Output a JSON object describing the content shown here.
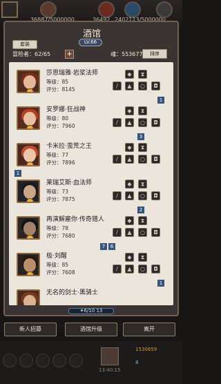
{
  "top_bar": {
    "resource_1_value": "36887",
    "resource_1_cap": "5000000",
    "resource_2_value": "36492",
    "resource_3_value": "2402113",
    "resource_3_cap": "5000000"
  },
  "tavern": {
    "title": "酒馆",
    "level": "LV.66",
    "tab_label": "套装",
    "adventurers_label": "冒险者：62/65",
    "add_label": "+",
    "soul_label": "魂：553677",
    "sort_label": "排序"
  },
  "heroes": [
    {
      "name": "莎恩瑞雅·岩浆法师",
      "level": "等级：85",
      "score": "评分：8145"
    },
    {
      "name": "安罗娜·狂战神",
      "level": "等级：80",
      "score": "评分：7960"
    },
    {
      "name": "卡米拉·蛮荒之王",
      "level": "等级：77",
      "score": "评分：7896"
    },
    {
      "name": "莱瑞艾斯·血法师",
      "level": "等级：73",
      "score": "评分：7875"
    },
    {
      "name": "再演解雇你·传奇猎人",
      "level": "等级：78",
      "score": "评分：7680"
    },
    {
      "name": "极·刘醒",
      "level": "等级：85",
      "score": "评分：7608"
    },
    {
      "name": "无名的剑士·黑骑士",
      "level": "",
      "score": ""
    }
  ],
  "side_tags": [
    "1",
    "3",
    "1",
    "2",
    "7",
    "6",
    "1"
  ],
  "exp_text": "✦6/10 13",
  "buttons": {
    "recruit": "新人招募",
    "upgrade": "酒馆升级",
    "leave": "离开"
  },
  "footer": {
    "coins": "1530659",
    "gems": "8",
    "time": "13:40:15"
  },
  "colors": {
    "panel_bg": "#ebe6dc",
    "slot_dark": "#2c2a28",
    "tag_blue": "#37547e",
    "emblem_gold": "#e9b03b"
  },
  "icons": [
    "water-drop-icon",
    "armor-icon",
    "sword-icon",
    "shield-icon",
    "ring-icon",
    "hourglass-icon"
  ]
}
